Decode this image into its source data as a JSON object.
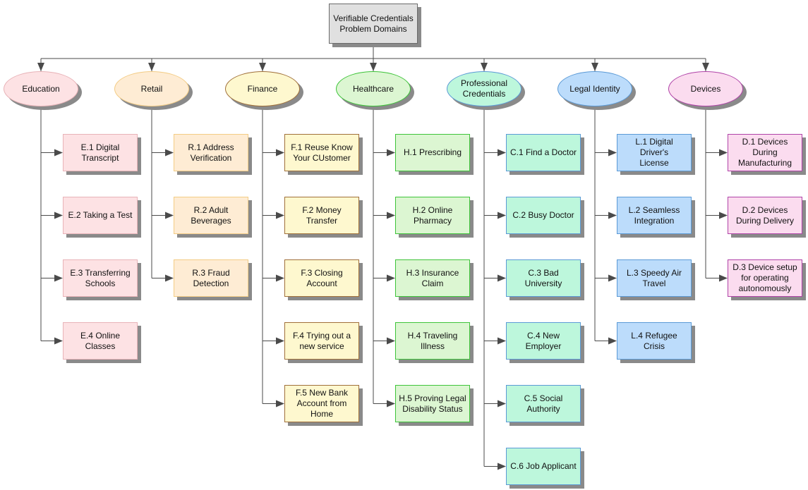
{
  "root": {
    "label": "Verifiable Credentials\nProblem Domains"
  },
  "domains": [
    {
      "key": "education",
      "label": "Education",
      "fill": "#fde2e4",
      "border": "#e8b3b8",
      "items": [
        "E.1 Digital\nTranscript",
        "E.2 Taking a Test",
        "E.3 Transferring\nSchools",
        "E.4 Online\nClasses"
      ]
    },
    {
      "key": "retail",
      "label": "Retail",
      "fill": "#feecd4",
      "border": "#f3cc85",
      "items": [
        "R.1 Address\nVerification",
        "R.2 Adult\nBeverages",
        "R.3 Fraud\nDetection"
      ]
    },
    {
      "key": "finance",
      "label": "Finance",
      "fill": "#fef8cf",
      "border": "#a0703a",
      "items": [
        "F.1 Reuse Know\nYour CUstomer",
        "F.2 Money\nTransfer",
        "F.3 Closing\nAccount",
        "F.4 Trying out a\nnew service",
        "F.5 New Bank\nAccount from\nHome"
      ]
    },
    {
      "key": "healthcare",
      "label": "Healthcare",
      "fill": "#dcf6d2",
      "border": "#3ec43a",
      "items": [
        "H.1 Prescribing",
        "H.2 Online\nPharmacy",
        "H.3 Insurance\nClaim",
        "H.4 Traveling\nIllness",
        "H.5 Proving Legal\nDisability Status"
      ]
    },
    {
      "key": "professional-credentials",
      "label": "Professional\nCredentials",
      "fill": "#bdf7dc",
      "border": "#5b9ad6",
      "items": [
        "C.1 Find a Doctor",
        "C.2 Busy Doctor",
        "C.3 Bad University",
        "C.4 New\nEmployer",
        "C.5 Social\nAuthority",
        "C.6 Job Applicant"
      ]
    },
    {
      "key": "legal-identity",
      "label": "Legal Identity",
      "fill": "#bcdcfb",
      "border": "#5b9ad6",
      "items": [
        "L.1 Digital Driver's\nLicense",
        "L.2 Seamless\nIntegration",
        "L.3 Speedy Air\nTravel",
        "L.4 Refugee Crisis"
      ]
    },
    {
      "key": "devices",
      "label": "Devices",
      "fill": "#fbdcef",
      "border": "#b043a8",
      "items": [
        "D.1 Devices\nDuring\nManufacturing",
        "D.2 Devices\nDuring Delivery",
        "D.3 Device setup\nfor operating\nautonomously"
      ]
    }
  ],
  "colors": {
    "connector": "#4a4a4a",
    "shadow": "#8a8a8a"
  }
}
